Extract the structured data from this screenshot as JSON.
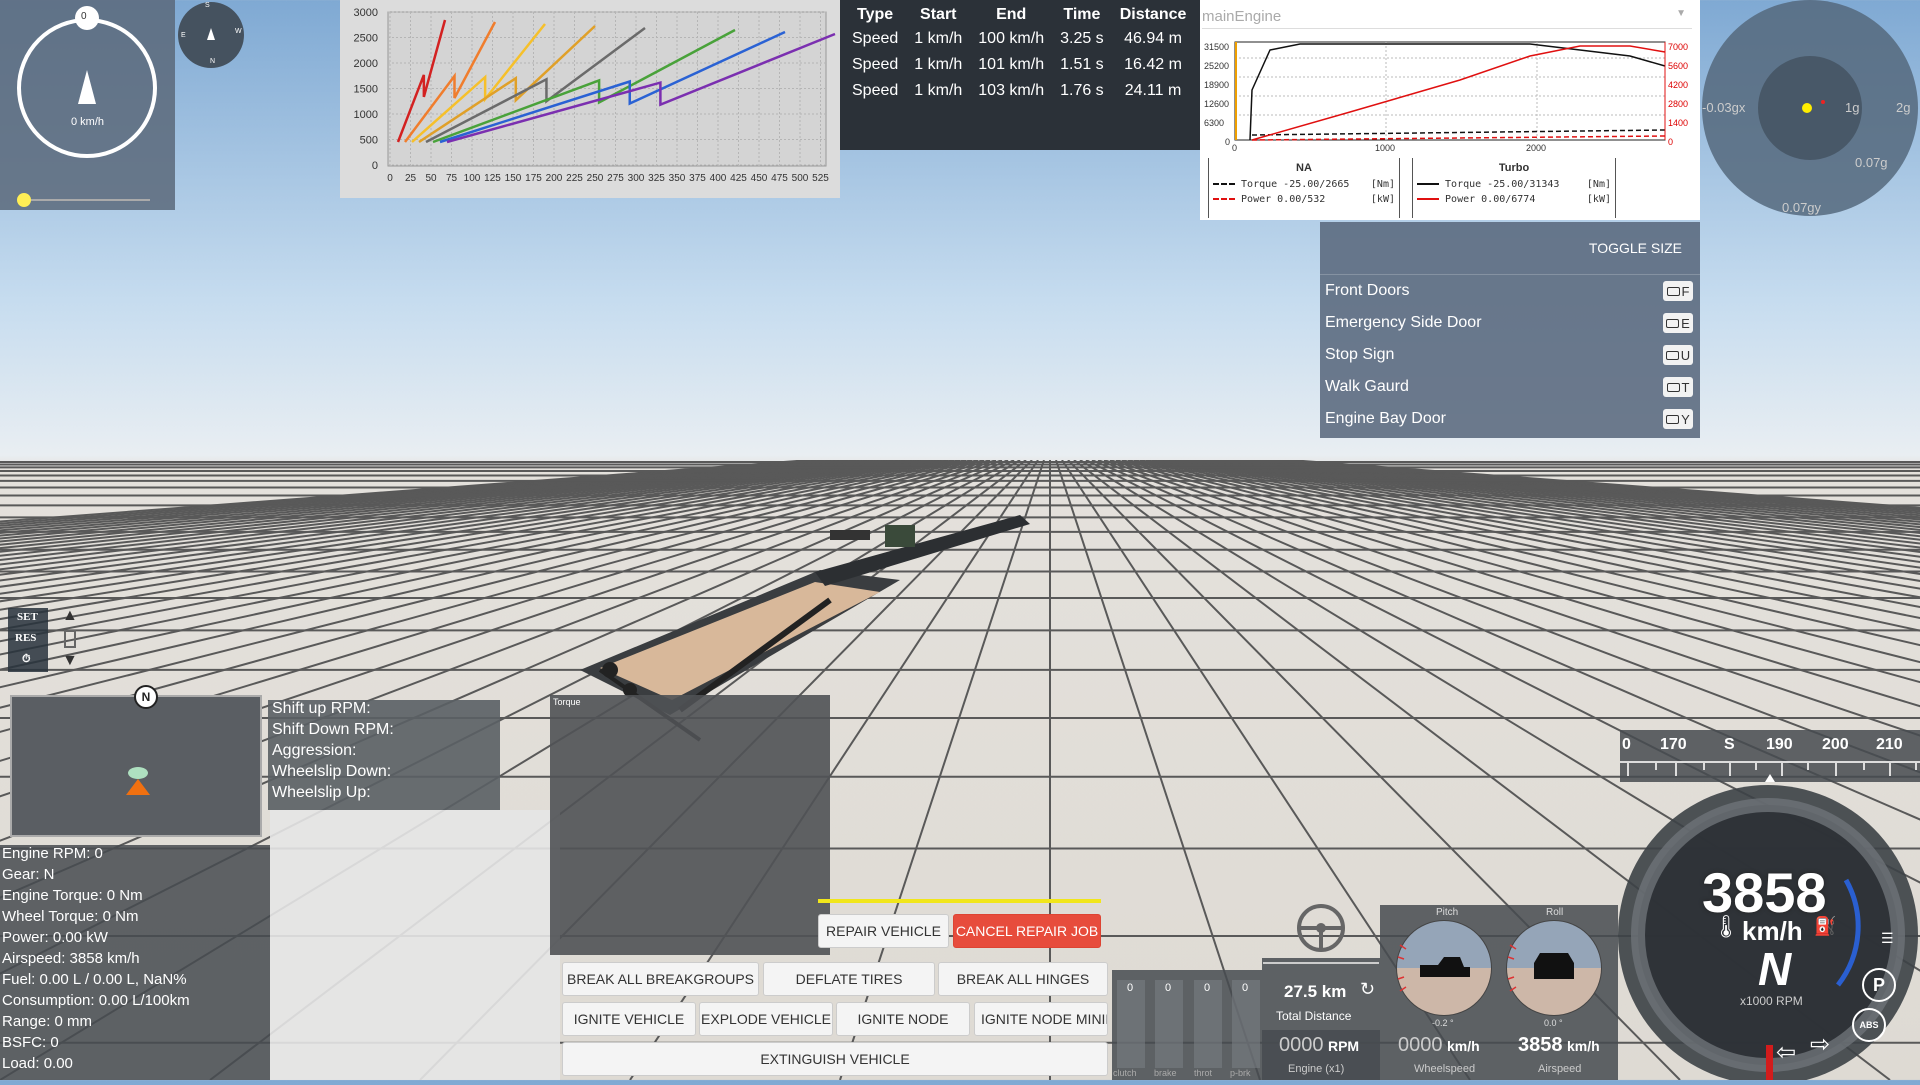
{
  "compass": {
    "speed": "0 km/h",
    "heading_marker": "0",
    "mini_compass": [
      "S",
      "W",
      "N",
      "E"
    ]
  },
  "accel_chart": {
    "ylabels": [
      "3000",
      "2500",
      "2000",
      "1500",
      "1000",
      "500",
      "0"
    ],
    "xlabels": [
      "0",
      "25",
      "50",
      "75",
      "100",
      "125",
      "150",
      "175",
      "200",
      "225",
      "250",
      "275",
      "300",
      "325",
      "350",
      "375",
      "400",
      "425",
      "450",
      "475",
      "500",
      "525"
    ],
    "colors": [
      "#d32121",
      "#f07d2d",
      "#f6c02a",
      "#e0a028",
      "#6b6b6b",
      "#49a23a",
      "#2a62d4",
      "#7b2fb0"
    ]
  },
  "accel_table": {
    "headers": [
      "Type",
      "Start",
      "End",
      "Time",
      "Distance"
    ],
    "rows": [
      [
        "Speed",
        "1 km/h",
        "100 km/h",
        "3.25 s",
        "46.94 m"
      ],
      [
        "Speed",
        "1 km/h",
        "101 km/h",
        "1.51 s",
        "16.42 m"
      ],
      [
        "Speed",
        "1 km/h",
        "103 km/h",
        "1.76 s",
        "24.11 m"
      ]
    ]
  },
  "engine": {
    "title": "mainEngine",
    "left_ticks": [
      "31500",
      "25200",
      "18900",
      "12600",
      "6300",
      "0"
    ],
    "right_ticks": [
      "7000",
      "5600",
      "4200",
      "2800",
      "1400",
      "0"
    ],
    "x_ticks": [
      "0",
      "1000",
      "2000"
    ],
    "na_title": "NA",
    "turbo_title": "Turbo",
    "na_torque": "Torque -25.00/2665",
    "na_torque_unit": "[Nm]",
    "na_power": "Power  0.00/532",
    "na_power_unit": "[kW]",
    "turbo_torque": "Torque -25.00/31343",
    "turbo_torque_unit": "[Nm]",
    "turbo_power": "Power  0.00/6774",
    "turbo_power_unit": "[kW]"
  },
  "gforce": {
    "left": "-0.03gx",
    "ring1": "1g",
    "ring2": "2g",
    "side": "0.07g",
    "bottom": "0.07gy"
  },
  "vehicle_menu": {
    "toggle_size": "TOGGLE SIZE",
    "items": [
      {
        "label": "Front Doors",
        "key": "F"
      },
      {
        "label": "Emergency Side Door",
        "key": "E"
      },
      {
        "label": "Stop Sign",
        "key": "U"
      },
      {
        "label": "Walk Gaurd",
        "key": "T"
      },
      {
        "label": "Engine Bay Door",
        "key": "Y"
      }
    ]
  },
  "cruise": {
    "set": "SET",
    "res": "RES"
  },
  "minimap": {
    "north": "N"
  },
  "shift": [
    "Shift up RPM:",
    "Shift Down RPM:",
    "Aggression:",
    "Wheelslip Down:",
    "Wheelslip Up:"
  ],
  "info": [
    "Engine RPM: 0",
    "Gear: N",
    "Engine Torque: 0 Nm",
    "Wheel Torque: 0 Nm",
    "Power: 0.00 kW",
    "Airspeed: 3858 km/h",
    "Fuel: 0.00 L / 0.00 L, NaN%",
    "Consumption: 0.00 L/100km",
    "Range: 0 mm",
    "BSFC: 0",
    "Load: 0.00"
  ],
  "torque_label": "Torque",
  "buttons": {
    "repair": "REPAIR VEHICLE",
    "cancel_repair": "CANCEL REPAIR JOB",
    "break_groups": "BREAK ALL BREAKGROUPS",
    "deflate": "DEFLATE TIRES",
    "break_hinges": "BREAK ALL HINGES",
    "ignite_vehicle": "IGNITE VEHICLE",
    "explode_vehicle": "EXPLODE VEHICLE",
    "ignite_node": "IGNITE NODE",
    "ignite_node_min": "IGNITE NODE MINIM",
    "extinguish": "EXTINGUISH VEHICLE"
  },
  "pedals": {
    "values": [
      "0",
      "0",
      "0",
      "0"
    ],
    "labels": [
      "clutch",
      "brake",
      "throt",
      "p-brk"
    ]
  },
  "distance": {
    "value": "27.5 km",
    "label": "Total Distance"
  },
  "readouts": {
    "engine_value": "0000",
    "engine_unit": "RPM",
    "engine_label": "Engine (x1)",
    "wheel_value": "0000",
    "wheel_unit": "km/h",
    "wheel_label": "Wheelspeed",
    "air_value": "3858",
    "air_unit": "km/h",
    "air_label": "Airspeed"
  },
  "pitchroll": {
    "pitch": "Pitch",
    "roll": "Roll",
    "pitch_val": "-0.2 °",
    "roll_val": "0.0 °"
  },
  "heading_tape": [
    "0",
    "170",
    "S",
    "190",
    "200",
    "210"
  ],
  "speedo": {
    "speed": "3858",
    "unit": "km/h",
    "gear": "N",
    "rpm_label": "x1000 RPM",
    "park": "P",
    "abs": "ABS"
  }
}
